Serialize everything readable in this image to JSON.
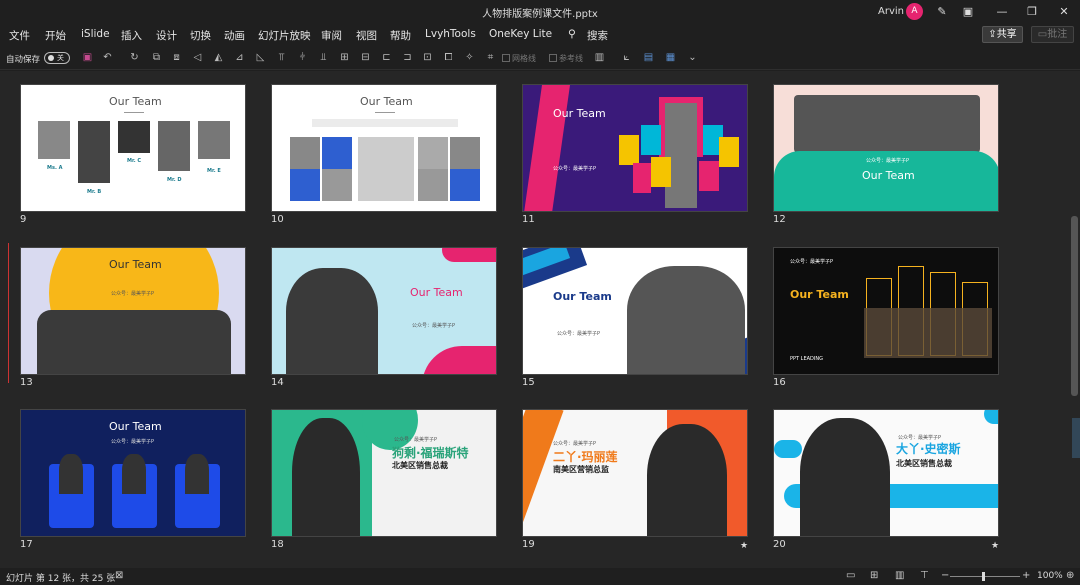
{
  "window": {
    "title": "人物排版案例课文件.pptx",
    "user_name": "Arvin",
    "avatar_letter": "A"
  },
  "menu": [
    "文件",
    "开始",
    "iSlide",
    "插入",
    "设计",
    "切换",
    "动画",
    "幻灯片放映",
    "审阅",
    "视图",
    "帮助",
    "LvyhTools",
    "OneKey Lite"
  ],
  "search_label": "搜索",
  "share_label": "共享",
  "comment_label": "批注",
  "toolbar": {
    "autosave_label": "自动保存",
    "autosave_state": "关",
    "gridlines_label": "网格线",
    "guides_label": "参考线"
  },
  "slides": [
    {
      "number": "9",
      "heading": "Our Team"
    },
    {
      "number": "10",
      "heading": "Our Team"
    },
    {
      "number": "11",
      "heading": "Our Team"
    },
    {
      "number": "12",
      "heading": "Our Team"
    },
    {
      "number": "13",
      "heading": "Our Team"
    },
    {
      "number": "14",
      "heading": "Our Team"
    },
    {
      "number": "15",
      "heading": "Our Team"
    },
    {
      "number": "16",
      "heading": "Our Team"
    },
    {
      "number": "17",
      "heading": "Our Team"
    },
    {
      "number": "18",
      "heading": "狗剩·福瑞斯特",
      "subtitle": "北美区销售总裁"
    },
    {
      "number": "19",
      "heading": "二丫·玛丽莲",
      "subtitle": "南美区营销总监"
    },
    {
      "number": "20",
      "heading": "大丫·史密斯",
      "subtitle": "北美区销售总裁"
    }
  ],
  "slide9_names": [
    "Ms. A",
    "Mr. B",
    "Mr. C",
    "Mr. D",
    "Mr. E"
  ],
  "wechat_label": "公众号：最美学子P",
  "ppt_leading": "PPT LEADING",
  "status": {
    "slide_info": "幻灯片 第 12 张，共 25 张",
    "zoom": "100%"
  },
  "colors": {
    "accent_red": "#e6246f",
    "green_text": "#2aa37a",
    "orange_text": "#f07a1b",
    "blue_text": "#1aa5e0"
  }
}
